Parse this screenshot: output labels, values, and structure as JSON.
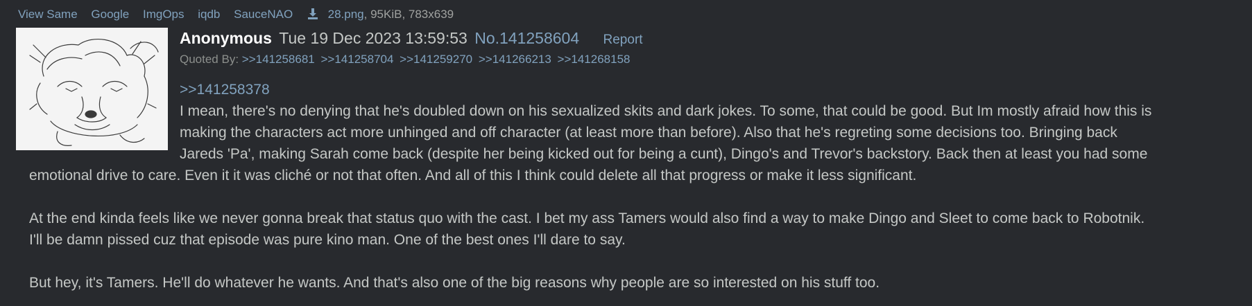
{
  "filebar": {
    "links": [
      "View Same",
      "Google",
      "ImgOps",
      "iqdb",
      "SauceNAO"
    ],
    "filename": "28.png",
    "fileinfo": ", 95KiB, 783x639"
  },
  "post": {
    "name": "Anonymous",
    "datetime": "Tue 19 Dec 2023 13:59:53",
    "number": "No.141258604",
    "report": "Report",
    "quoted_by_label": "Quoted By:",
    "quoted_by": [
      ">>141258681",
      ">>141258704",
      ">>141259270",
      ">>141266213",
      ">>141268158"
    ],
    "quote_link": ">>141258378",
    "lines": [
      "I mean, there's no denying that he's doubled down on his sexualized skits and dark jokes. To some, that could be good. But Im mostly afraid how this is",
      "making the characters act more unhinged and off character (at least more than before). Also that he's regreting some decisions too. Bringing back",
      "Jareds 'Pa', making Sarah come back (despite her being kicked out for being a cunt), Dingo's and Trevor's backstory. Back then at least you had some",
      "emotional drive to care. Even it it was cliché or not that often. And all of this I think could delete all that progress or make it less significant.",
      "At the end kinda feels like we never gonna break that status quo with the cast. I bet my ass Tamers would also find a way to make Dingo and Sleet to come back to Robotnik.",
      "I'll be damn pissed cuz that episode was pure kino man. One of the best ones I'll dare to say.",
      "But hey, it's Tamers. He'll do whatever he wants. And that's also one of the big reasons why people are so interested on his stuff too."
    ]
  }
}
